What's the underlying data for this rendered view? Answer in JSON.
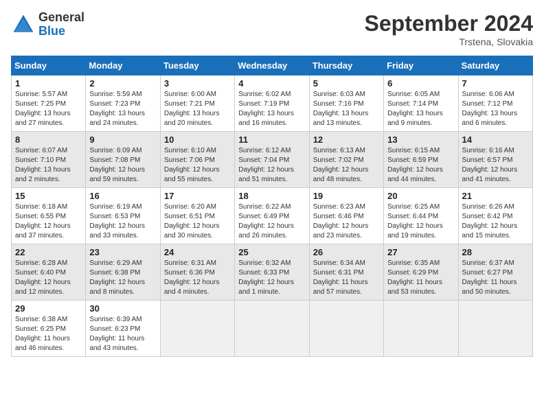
{
  "header": {
    "logo_general": "General",
    "logo_blue": "Blue",
    "month_title": "September 2024",
    "location": "Trstena, Slovakia"
  },
  "weekdays": [
    "Sunday",
    "Monday",
    "Tuesday",
    "Wednesday",
    "Thursday",
    "Friday",
    "Saturday"
  ],
  "weeks": [
    [
      {
        "day": "1",
        "sunrise": "Sunrise: 5:57 AM",
        "sunset": "Sunset: 7:25 PM",
        "daylight": "Daylight: 13 hours and 27 minutes."
      },
      {
        "day": "2",
        "sunrise": "Sunrise: 5:59 AM",
        "sunset": "Sunset: 7:23 PM",
        "daylight": "Daylight: 13 hours and 24 minutes."
      },
      {
        "day": "3",
        "sunrise": "Sunrise: 6:00 AM",
        "sunset": "Sunset: 7:21 PM",
        "daylight": "Daylight: 13 hours and 20 minutes."
      },
      {
        "day": "4",
        "sunrise": "Sunrise: 6:02 AM",
        "sunset": "Sunset: 7:19 PM",
        "daylight": "Daylight: 13 hours and 16 minutes."
      },
      {
        "day": "5",
        "sunrise": "Sunrise: 6:03 AM",
        "sunset": "Sunset: 7:16 PM",
        "daylight": "Daylight: 13 hours and 13 minutes."
      },
      {
        "day": "6",
        "sunrise": "Sunrise: 6:05 AM",
        "sunset": "Sunset: 7:14 PM",
        "daylight": "Daylight: 13 hours and 9 minutes."
      },
      {
        "day": "7",
        "sunrise": "Sunrise: 6:06 AM",
        "sunset": "Sunset: 7:12 PM",
        "daylight": "Daylight: 13 hours and 6 minutes."
      }
    ],
    [
      {
        "day": "8",
        "sunrise": "Sunrise: 6:07 AM",
        "sunset": "Sunset: 7:10 PM",
        "daylight": "Daylight: 13 hours and 2 minutes."
      },
      {
        "day": "9",
        "sunrise": "Sunrise: 6:09 AM",
        "sunset": "Sunset: 7:08 PM",
        "daylight": "Daylight: 12 hours and 59 minutes."
      },
      {
        "day": "10",
        "sunrise": "Sunrise: 6:10 AM",
        "sunset": "Sunset: 7:06 PM",
        "daylight": "Daylight: 12 hours and 55 minutes."
      },
      {
        "day": "11",
        "sunrise": "Sunrise: 6:12 AM",
        "sunset": "Sunset: 7:04 PM",
        "daylight": "Daylight: 12 hours and 51 minutes."
      },
      {
        "day": "12",
        "sunrise": "Sunrise: 6:13 AM",
        "sunset": "Sunset: 7:02 PM",
        "daylight": "Daylight: 12 hours and 48 minutes."
      },
      {
        "day": "13",
        "sunrise": "Sunrise: 6:15 AM",
        "sunset": "Sunset: 6:59 PM",
        "daylight": "Daylight: 12 hours and 44 minutes."
      },
      {
        "day": "14",
        "sunrise": "Sunrise: 6:16 AM",
        "sunset": "Sunset: 6:57 PM",
        "daylight": "Daylight: 12 hours and 41 minutes."
      }
    ],
    [
      {
        "day": "15",
        "sunrise": "Sunrise: 6:18 AM",
        "sunset": "Sunset: 6:55 PM",
        "daylight": "Daylight: 12 hours and 37 minutes."
      },
      {
        "day": "16",
        "sunrise": "Sunrise: 6:19 AM",
        "sunset": "Sunset: 6:53 PM",
        "daylight": "Daylight: 12 hours and 33 minutes."
      },
      {
        "day": "17",
        "sunrise": "Sunrise: 6:20 AM",
        "sunset": "Sunset: 6:51 PM",
        "daylight": "Daylight: 12 hours and 30 minutes."
      },
      {
        "day": "18",
        "sunrise": "Sunrise: 6:22 AM",
        "sunset": "Sunset: 6:49 PM",
        "daylight": "Daylight: 12 hours and 26 minutes."
      },
      {
        "day": "19",
        "sunrise": "Sunrise: 6:23 AM",
        "sunset": "Sunset: 6:46 PM",
        "daylight": "Daylight: 12 hours and 23 minutes."
      },
      {
        "day": "20",
        "sunrise": "Sunrise: 6:25 AM",
        "sunset": "Sunset: 6:44 PM",
        "daylight": "Daylight: 12 hours and 19 minutes."
      },
      {
        "day": "21",
        "sunrise": "Sunrise: 6:26 AM",
        "sunset": "Sunset: 6:42 PM",
        "daylight": "Daylight: 12 hours and 15 minutes."
      }
    ],
    [
      {
        "day": "22",
        "sunrise": "Sunrise: 6:28 AM",
        "sunset": "Sunset: 6:40 PM",
        "daylight": "Daylight: 12 hours and 12 minutes."
      },
      {
        "day": "23",
        "sunrise": "Sunrise: 6:29 AM",
        "sunset": "Sunset: 6:38 PM",
        "daylight": "Daylight: 12 hours and 8 minutes."
      },
      {
        "day": "24",
        "sunrise": "Sunrise: 6:31 AM",
        "sunset": "Sunset: 6:36 PM",
        "daylight": "Daylight: 12 hours and 4 minutes."
      },
      {
        "day": "25",
        "sunrise": "Sunrise: 6:32 AM",
        "sunset": "Sunset: 6:33 PM",
        "daylight": "Daylight: 12 hours and 1 minute."
      },
      {
        "day": "26",
        "sunrise": "Sunrise: 6:34 AM",
        "sunset": "Sunset: 6:31 PM",
        "daylight": "Daylight: 11 hours and 57 minutes."
      },
      {
        "day": "27",
        "sunrise": "Sunrise: 6:35 AM",
        "sunset": "Sunset: 6:29 PM",
        "daylight": "Daylight: 11 hours and 53 minutes."
      },
      {
        "day": "28",
        "sunrise": "Sunrise: 6:37 AM",
        "sunset": "Sunset: 6:27 PM",
        "daylight": "Daylight: 11 hours and 50 minutes."
      }
    ],
    [
      {
        "day": "29",
        "sunrise": "Sunrise: 6:38 AM",
        "sunset": "Sunset: 6:25 PM",
        "daylight": "Daylight: 11 hours and 46 minutes."
      },
      {
        "day": "30",
        "sunrise": "Sunrise: 6:39 AM",
        "sunset": "Sunset: 6:23 PM",
        "daylight": "Daylight: 11 hours and 43 minutes."
      },
      null,
      null,
      null,
      null,
      null
    ]
  ]
}
